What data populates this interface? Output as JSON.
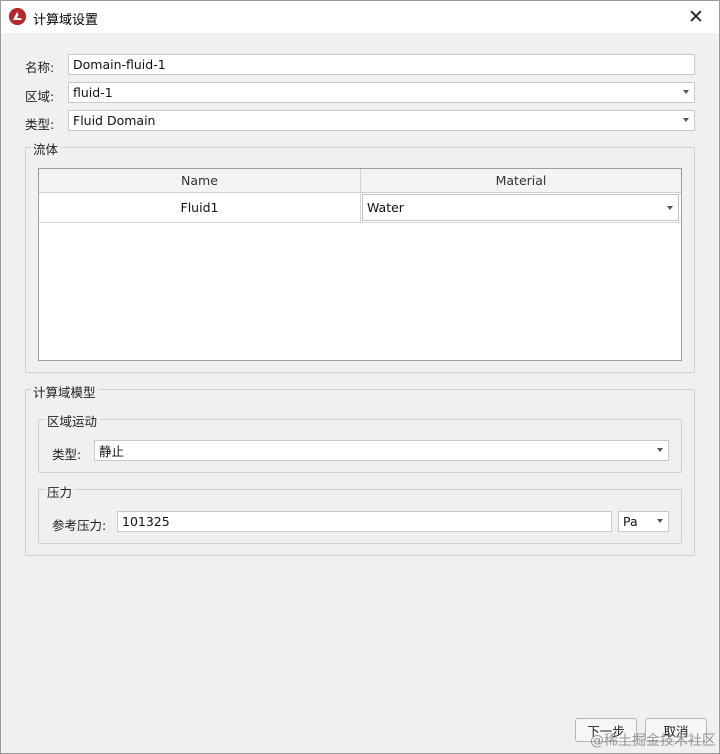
{
  "window": {
    "title": "计算域设置",
    "close_symbol": "✕"
  },
  "form": {
    "name_label": "名称:",
    "name_value": "Domain-fluid-1",
    "region_label": "区域:",
    "region_value": "fluid-1",
    "type_label": "类型:",
    "type_value": "Fluid Domain"
  },
  "fluid_group": {
    "title": "流体",
    "columns": [
      "Name",
      "Material"
    ],
    "rows": [
      {
        "name": "Fluid1",
        "material": "Water"
      }
    ]
  },
  "domain_model": {
    "title": "计算域模型",
    "motion": {
      "title": "区域运动",
      "type_label": "类型:",
      "type_value": "静止"
    },
    "pressure": {
      "title": "压力",
      "ref_label": "参考压力:",
      "ref_value": "101325",
      "unit": "Pa"
    }
  },
  "buttons": {
    "next": "下一步",
    "cancel": "取消"
  },
  "watermark": "@稀土掘金技术社区",
  "colors": {
    "app_icon": "#b32a2a"
  }
}
